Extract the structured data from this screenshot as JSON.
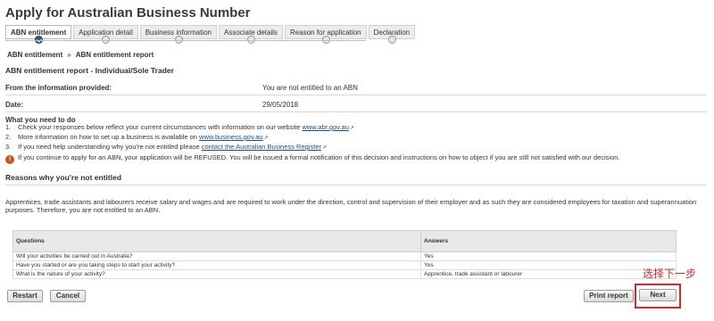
{
  "page": {
    "title": "Apply for Australian Business Number"
  },
  "steps": [
    {
      "label": "ABN entitlement",
      "active": true
    },
    {
      "label": "Application detail",
      "active": false
    },
    {
      "label": "Business information",
      "active": false
    },
    {
      "label": "Associate details",
      "active": false
    },
    {
      "label": "Reason for application",
      "active": false
    },
    {
      "label": "Declaration",
      "active": false
    }
  ],
  "breadcrumb": {
    "first": "ABN entitlement",
    "separator": "»",
    "second": "ABN entitlement report"
  },
  "report": {
    "heading": "ABN entitlement report - Individual/Sole Trader",
    "provided_label": "From the information provided:",
    "provided_value": "You are not entitled to an ABN",
    "date_label": "Date:",
    "date_value": "29/05/2018"
  },
  "todo": {
    "title": "What you need to do",
    "items": [
      {
        "num": "1.",
        "text": "Check your responses below reflect your current circumstances with information on our website ",
        "link": "www.abr.gov.au"
      },
      {
        "num": "2.",
        "text": "More information on how to set up a business is available on ",
        "link": "www.business.gov.au"
      },
      {
        "num": "3.",
        "text": "If you need help understanding why you're not entitled please ",
        "link": "contact the Australian Business Register"
      }
    ]
  },
  "warning": {
    "icon": "warning-icon",
    "text": "If you continue to apply for an ABN, your application will be REFUSED. You will be issued a formal notification of this decision and instructions on how to object if you are still not satisfied with our decision."
  },
  "reasons": {
    "title": "Reasons why you're not entitled",
    "text": "Apprentices, trade assistants and labourers receive salary and wages and are required to work under the direction, control and supervision of their employer and as such they are considered employees for taxation and superannuation purposes. Therefore, you are not entitled to an ABN."
  },
  "qa_table": {
    "headers": [
      "Questions",
      "Answers"
    ],
    "rows": [
      [
        "Will your activities be carried out in Australia?",
        "Yes"
      ],
      [
        "Have you started or are you taking steps to start your activity?",
        "Yes"
      ],
      [
        "What is the nature of your activity?",
        "Apprentice, trade assistant or labourer"
      ]
    ]
  },
  "buttons": {
    "restart": "Restart",
    "cancel": "Cancel",
    "print": "Print report",
    "next": "Next"
  },
  "annotation": {
    "text": "选择下一步",
    "color": "#d62828"
  }
}
